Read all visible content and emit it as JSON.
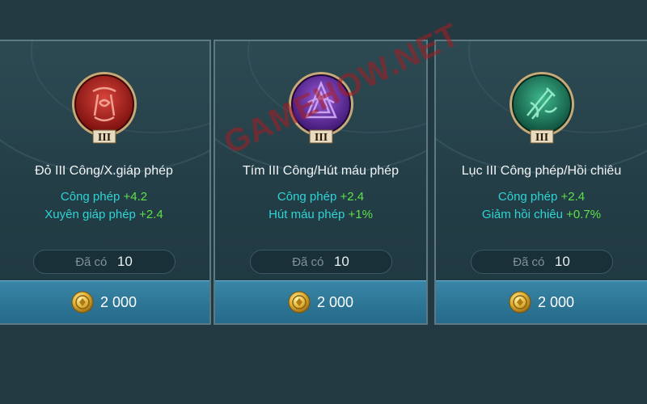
{
  "cards": [
    {
      "title": "Đỏ III Công/X.giáp phép",
      "emblem_icon": "red-rune-emblem-icon",
      "tier": "III",
      "color": "#b8201c",
      "stats": [
        {
          "name": "Công phép",
          "value": "+4.2"
        },
        {
          "name": "Xuyên giáp phép",
          "value": "+2.4"
        }
      ],
      "owned_label": "Đã có",
      "owned_count": "10",
      "price": "2 000"
    },
    {
      "title": "Tím III Công/Hút máu phép",
      "emblem_icon": "purple-rune-emblem-icon",
      "tier": "III",
      "color": "#6a2fa8",
      "stats": [
        {
          "name": "Công phép",
          "value": "+2.4"
        },
        {
          "name": "Hút máu phép",
          "value": "+1%"
        }
      ],
      "owned_label": "Đã có",
      "owned_count": "10",
      "price": "2 000"
    },
    {
      "title": "Lục III Công phép/Hồi chiêu",
      "emblem_icon": "green-rune-emblem-icon",
      "tier": "III",
      "color": "#1f8a6a",
      "stats": [
        {
          "name": "Công phép",
          "value": "+2.4"
        },
        {
          "name": "Giảm hồi chiêu",
          "value": "+0.7%"
        }
      ],
      "owned_label": "Đã có",
      "owned_count": "10",
      "price": "2 000"
    }
  ],
  "watermark": "GAMEHOW.NET",
  "colors": {
    "stat_name": "#2fd4d4",
    "stat_value": "#5fe04a",
    "price_bar": "#2f7898",
    "coin": "#d6a62a"
  }
}
